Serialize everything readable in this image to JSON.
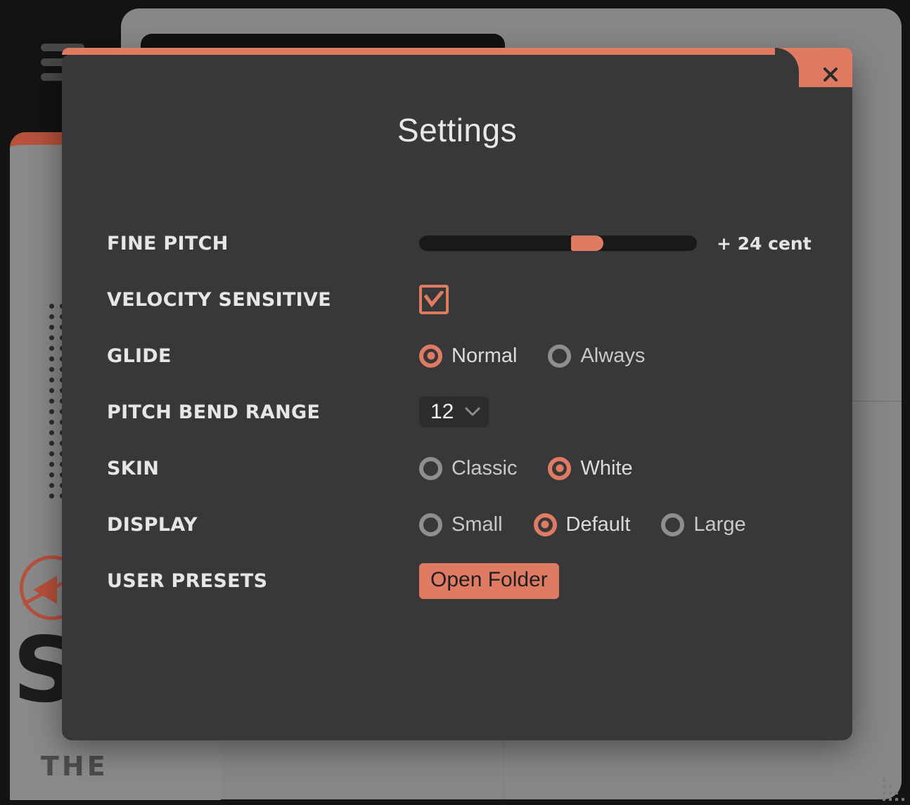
{
  "background": {
    "logo_word": "SUB",
    "logo_sub": "THE",
    "menu_icon": "hamburger-icon",
    "logo_icon": "circle-arrow-logo-icon"
  },
  "modal": {
    "title": "Settings",
    "close_label": "✕",
    "accent_color": "#E07B63",
    "surface_color": "#383838",
    "rows": [
      {
        "label": "FINE PITCH",
        "type": "slider",
        "value_text": "+ 24 cent",
        "percent": 62
      },
      {
        "label": "VELOCITY SENSITIVE",
        "type": "checkbox",
        "checked": true
      },
      {
        "label": "GLIDE",
        "type": "radio",
        "options": [
          "Normal",
          "Always"
        ],
        "selected": "Normal"
      },
      {
        "label": "PITCH BEND RANGE",
        "type": "select",
        "value": "12"
      },
      {
        "label": "SKIN",
        "type": "radio",
        "options": [
          "Classic",
          "White"
        ],
        "selected": "White"
      },
      {
        "label": "DISPLAY",
        "type": "radio",
        "options": [
          "Small",
          "Default",
          "Large"
        ],
        "selected": "Default"
      },
      {
        "label": "USER PRESETS",
        "type": "button",
        "button_label": "Open Folder"
      }
    ]
  }
}
